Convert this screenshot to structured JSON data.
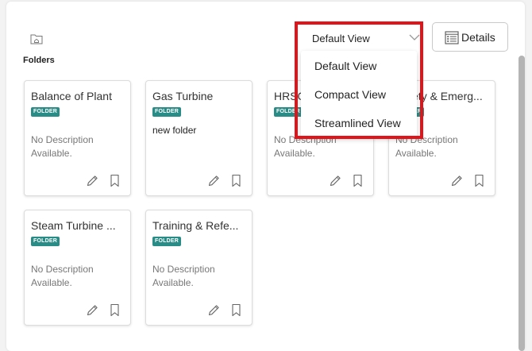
{
  "header": {
    "folders_label": "Folders",
    "view_select_value": "Default View",
    "details_label": "Details"
  },
  "view_menu": {
    "options": [
      "Default View",
      "Compact View",
      "Streamlined View"
    ]
  },
  "cards": [
    {
      "title": "Balance of Plant",
      "badge": "FOLDER",
      "description": "No Description Available."
    },
    {
      "title": "Gas Turbine",
      "badge": "FOLDER",
      "note": "new folder"
    },
    {
      "title": "HRSG",
      "badge": "FOLDER",
      "description": "No Description Available."
    },
    {
      "title": "Safety & Emerg...",
      "badge": "FOLDER",
      "description": "No Description Available."
    },
    {
      "title": "Steam Turbine ...",
      "badge": "FOLDER",
      "description": "No Description Available."
    },
    {
      "title": "Training & Refe...",
      "badge": "FOLDER",
      "description": "No Description Available."
    }
  ],
  "colors": {
    "badge": "#2a8c86",
    "highlight": "#e2141a"
  },
  "icons": [
    "folder-home-icon",
    "chevron-down-icon",
    "details-list-icon",
    "edit-pencil-icon",
    "bookmark-icon"
  ]
}
